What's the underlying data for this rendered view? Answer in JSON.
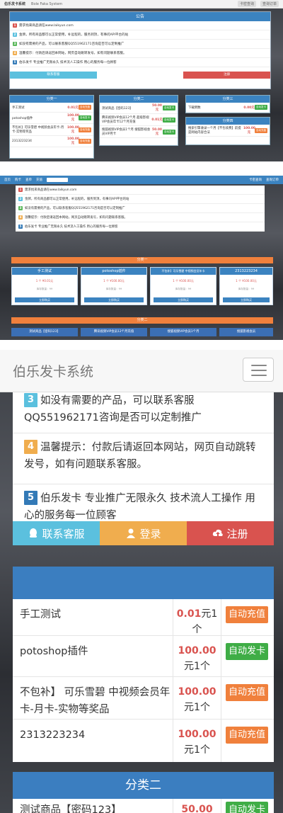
{
  "panel1": {
    "brand": "伯乐发卡系统",
    "brand_sub": "Bole Faka System",
    "nav_right": [
      "卡密查询",
      "查询订单"
    ],
    "notice_title": "公告",
    "notices": [
      "需求找来商品请在www.laikyun.com",
      "金牌，所有商品都可以正常使用，补远程的，服务到顶，有事问API平台的站",
      "如没有需要的产品，可以联系客服QQ551962171咨询是否可以定制推广",
      "温馨提示：付款后请返回本网站，网页自动跳转发号，如有问题联系客服。",
      "伯乐发卡 专业推广无限永久 技术流人工操作 用心的服务每一位顾客"
    ],
    "btn_left": "联系客服",
    "btn_right": "注册",
    "cards": [
      {
        "title": "分类一",
        "rows": [
          {
            "name": "手工测试",
            "price": "0.01元",
            "tag": "自动充值"
          },
          {
            "name": "potoshop插件",
            "price": "100.00元",
            "tag": "自动发卡"
          },
          {
            "name": "不包补】可乐雪碧 中视频会员年卡-月卡-实物等奖品",
            "price": "100.00元",
            "tag": "自动充值"
          },
          {
            "name": "2313223234",
            "price": "100.00元",
            "tag": "自动充值"
          }
        ]
      },
      {
        "title": "分类二",
        "rows": [
          {
            "name": "测试商品【密码123】",
            "price": "50.00元",
            "tag": "自动发卡"
          },
          {
            "name": "腾讯视频VIP会员12个月 超级影视VIP会员年卡12个月充值",
            "price": "0.01元",
            "tag": "自动发卡"
          },
          {
            "name": "搜狐视频VIP会员1个月 搜狐影视会员VIP月卡",
            "price": "50.00元",
            "tag": "自动发卡"
          }
        ]
      },
      {
        "title": "分类三",
        "rows": [
          {
            "name": "下载倒数",
            "price": "0.00元",
            "tag": "自动发卡"
          }
        ],
        "sub_title": "分类四",
        "sub_rows": [
          {
            "name": "搜索引擎收录一个月【不包续费】前提是网站内容合法",
            "price": "100.00元",
            "tag": "自动充值"
          }
        ]
      }
    ]
  },
  "panel2": {
    "nav": [
      "首页",
      "购卡",
      "查单",
      "充值"
    ],
    "nav_right": [
      "卡密查询",
      "查询订单"
    ],
    "notices": [
      "需求找来商品请在www.laikyun.com",
      "金牌，所有商品都可以正常使用，补远程的，服务到顶，有事问API平台的站",
      "如没有需要的产品，可以联系客服QQ551962171咨询是否可以定制推广",
      "温馨提示：付款后请返回本网站，网页自动跳转发号，如有问题联系客服。",
      "伯乐发卡 专业推广无限永久 技术流人工操作 用心的服务每一位顾客"
    ],
    "cat1_bar": "分类一",
    "cards": [
      {
        "title": "手工测试",
        "price": "1 个 ¥0.01元",
        "stock": "库存数量：99",
        "buy": "立即购买"
      },
      {
        "title": "potoshop插件",
        "price": "1 个 ¥100.00元",
        "stock": "库存数量：99",
        "buy": "立即购买"
      },
      {
        "title": "不包补】可乐雪碧 中视频会员年卡",
        "price": "1 个 ¥100.00元",
        "stock": "库存数量：99",
        "buy": "立即购买"
      },
      {
        "title": "2313223234",
        "price": "1 个 ¥100.00元",
        "stock": "库存数量：99",
        "buy": "立即购买"
      }
    ],
    "cat2_bar": "分类二",
    "cat2_items": [
      "测试商品【密码123】",
      "腾讯视频VIP会员12个月充值",
      "搜狐视频VIP会员1个月",
      "搜狐影视会员"
    ]
  },
  "panel3": {
    "title": "伯乐发卡系统",
    "notices": [
      {
        "num": "3",
        "text": "如没有需要的产品，可以联系客服QQ551962171咨询是否可以定制推广"
      },
      {
        "num": "4",
        "text": "温馨提示：付款后请返回本网站，网页自动跳转发号，如有问题联系客服。"
      },
      {
        "num": "5",
        "text": "伯乐发卡 专业推广无限永久 技术流人工操作 用心的服务每一位顾客"
      }
    ],
    "buttons": {
      "contact": "联系客服",
      "login": "登录",
      "register": "注册"
    },
    "category1": {
      "title": "",
      "rows": [
        {
          "name": "手工测试",
          "price": "0.01",
          "unit": "元",
          "qty": "1个",
          "tag": "自动充值"
        },
        {
          "name": "potoshop插件",
          "price": "100.00",
          "unit": "元",
          "qty": "1个",
          "tag": "自动发卡"
        },
        {
          "name": "不包补】 可乐雪碧 中视频会员年卡-月卡-实物等奖品",
          "price": "100.00",
          "unit": "元",
          "qty": "1个",
          "tag": "自动充值"
        },
        {
          "name": "2313223234",
          "price": "100.00",
          "unit": "元",
          "qty": "1个",
          "tag": "自动充值"
        }
      ]
    },
    "category2": {
      "title": "分类二",
      "rows": [
        {
          "name": "测试商品【密码123】",
          "price": "50.00",
          "tag": "自动发卡"
        }
      ]
    }
  },
  "colors": {
    "header_blue": "#3b7ec0",
    "tag_orange": "#f0803c",
    "tag_green": "#3fad46",
    "price_red": "#d9534f",
    "btn_contact": "#5bc0de",
    "btn_login": "#f0ad4e",
    "btn_register": "#d9534f"
  }
}
